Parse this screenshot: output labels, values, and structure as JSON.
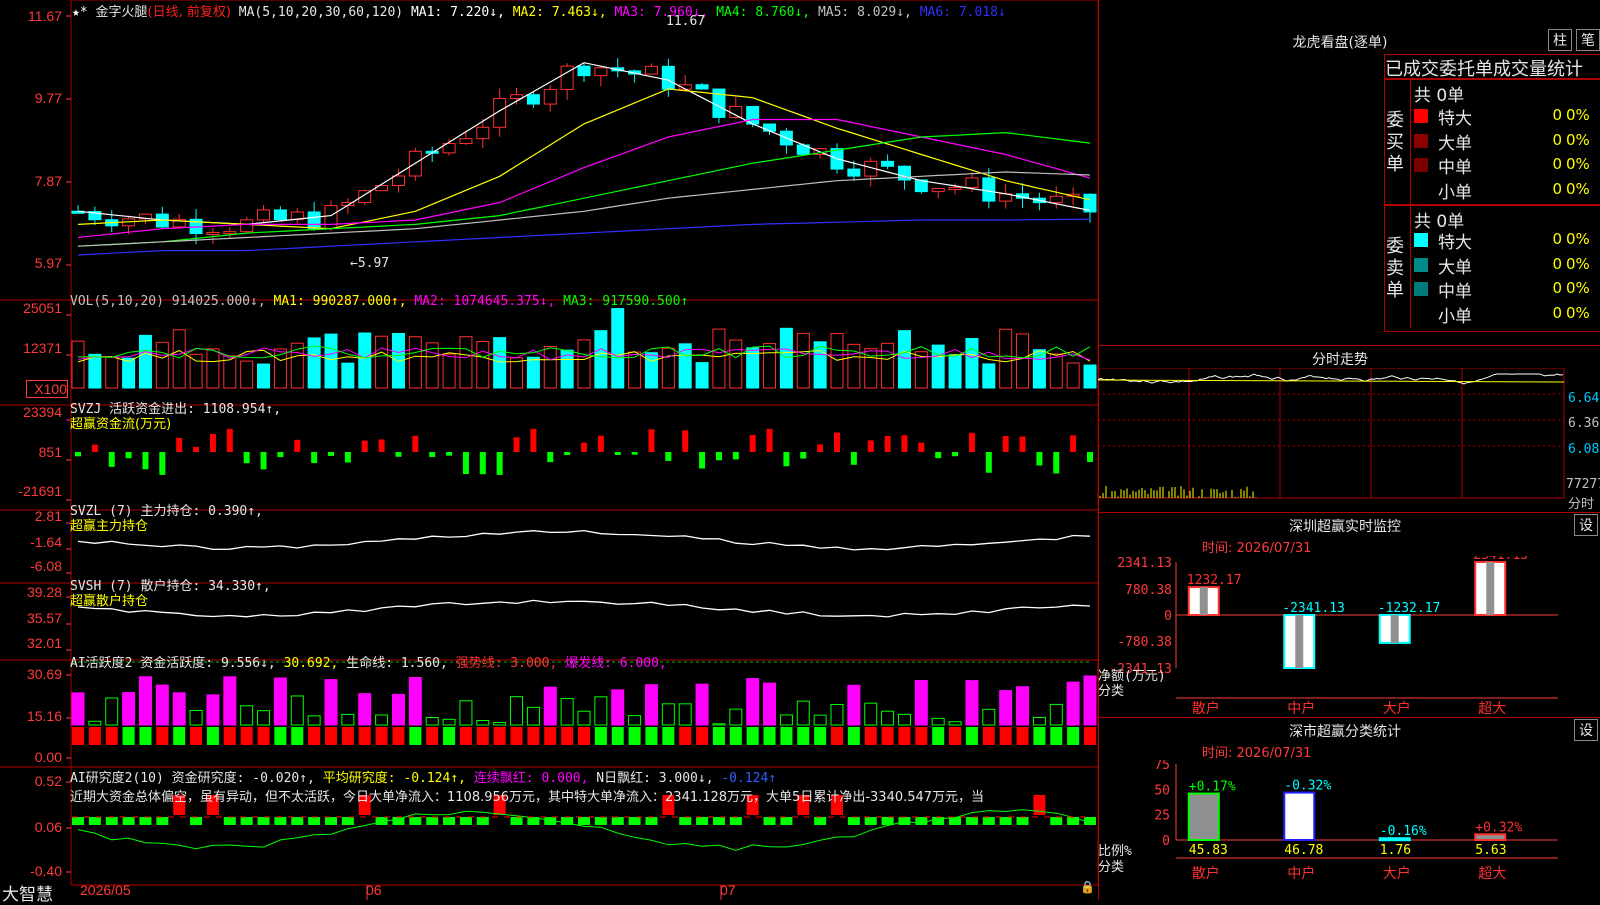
{
  "main_header": {
    "stock_name": "金字火腿",
    "period_label": "(日线, 前复权)",
    "ma_spec": "MA(5,10,20,30,60,120)",
    "ma_items": [
      {
        "label": "MA1: 7.220↓,",
        "color": "#ffffff"
      },
      {
        "label": "MA2: 7.463↓,",
        "color": "#ffff00"
      },
      {
        "label": "MA3: 7.960↓,",
        "color": "#ff00ff"
      },
      {
        "label": "MA4: 8.760↓,",
        "color": "#00ff00"
      },
      {
        "label": "MA5: 8.029↓,",
        "color": "#c0c0c0"
      },
      {
        "label": "MA6: 7.018↓",
        "color": "#3030ff"
      }
    ],
    "y_ticks": [
      "11.67",
      "9.77",
      "7.87",
      "5.97"
    ],
    "high_marker": "11.67",
    "low_marker": "←5.97"
  },
  "vol_panel": {
    "header": "VOL(5,10,20) 914025.000↓, MA1: 990287.000↑, MA2: 1074645.375↓, MA3: 917590.500↑",
    "header_parts": [
      {
        "t": "VOL(5,10,20) 914025.000↓,",
        "c": "#c0c0c0"
      },
      {
        "t": " MA1: 990287.000↑,",
        "c": "#ffff00"
      },
      {
        "t": " MA2: 1074645.375↓,",
        "c": "#ff00ff"
      },
      {
        "t": " MA3: 917590.500↑",
        "c": "#00ff00"
      }
    ],
    "y_ticks": [
      "25051",
      "12371",
      "X100"
    ]
  },
  "svzj_panel": {
    "header": "SVZJ  活跃资金进出: 1108.954↑,",
    "sub": "超赢资金流(万元)",
    "y_ticks": [
      "23394",
      "851",
      "-21691"
    ]
  },
  "svzl_panel": {
    "header": "SVZL (7) 主力持仓: 0.390↑,",
    "sub": "超赢主力持仓",
    "y_ticks": [
      "2.81",
      "-1.64",
      "-6.08"
    ]
  },
  "svsh_panel": {
    "header": "SVSH (7) 散户持仓: 34.330↑,",
    "sub": "超赢散户持仓",
    "y_ticks": [
      "39.28",
      "35.57",
      "32.01"
    ]
  },
  "ai_active_panel": {
    "header_parts": [
      {
        "t": "AI活跃度2 资金活跃度: 9.556↓,",
        "c": "#e6e6e6"
      },
      {
        "t": " 30.692,",
        "c": "#ffff00"
      },
      {
        "t": " 生命线: 1.560,",
        "c": "#e6e6e6"
      },
      {
        "t": " 强势线: 3.000,",
        "c": "#ff3333"
      },
      {
        "t": " 爆发线: 6.000,",
        "c": "#ff00ff"
      }
    ],
    "y_ticks": [
      "30.69",
      "15.16",
      "0.00"
    ]
  },
  "ai_research_panel": {
    "header_parts": [
      {
        "t": "AI研究度2(10) 资金研究度: -0.020↑,",
        "c": "#e6e6e6"
      },
      {
        "t": " 平均研究度: -0.124↑,",
        "c": "#ffff00"
      },
      {
        "t": " 连续飘红: 0.000,",
        "c": "#ff00ff"
      },
      {
        "t": " N日飘红: 3.000↓,",
        "c": "#e6e6e6"
      },
      {
        "t": " -0.124↑",
        "c": "#3060ff"
      }
    ],
    "summary": "近期大资金总体偏空，虽有异动，但不太活跃，今日大单净流入：1108.956万元，其中特大单净流入：2341.128万元，大单5日累计净出-3340.547万元，当",
    "y_ticks": [
      "0.52",
      "0.06",
      "-0.40"
    ]
  },
  "bottom_axis": {
    "brand": "大智慧",
    "dates": [
      "2026/05",
      "06",
      "07"
    ]
  },
  "lhb": {
    "title": "龙虎看盘(逐单)",
    "btn_zhu": "柱",
    "btn_bi": "笔",
    "tabs_header": "已成交委托单成交量统计",
    "buy_label": "委买单",
    "sell_label": "委卖单",
    "buy_total": "共 0单",
    "sell_total": "共 0单",
    "buy_rows": [
      {
        "name": "特大",
        "count": "0",
        "pct": "0%",
        "color": "#ff0000"
      },
      {
        "name": "大单",
        "count": "0",
        "pct": "0%",
        "color": "#8b0000"
      },
      {
        "name": "中单",
        "count": "0",
        "pct": "0%",
        "color": "#7a0000"
      },
      {
        "name": "小单",
        "count": "0",
        "pct": "0%",
        "color": "#000000"
      }
    ],
    "sell_rows": [
      {
        "name": "特大",
        "count": "0",
        "pct": "0%",
        "color": "#00ffff"
      },
      {
        "name": "大单",
        "count": "0",
        "pct": "0%",
        "color": "#008b8b"
      },
      {
        "name": "中单",
        "count": "0",
        "pct": "0%",
        "color": "#007a7a"
      },
      {
        "name": "小单",
        "count": "0",
        "pct": "0%",
        "color": "#000000"
      }
    ]
  },
  "intraday": {
    "title": "分时走势",
    "y_ticks": [
      "6.64",
      "6.36",
      "6.08"
    ],
    "vol_tick": "77277",
    "foot": "分时"
  },
  "sz_monitor": {
    "title": "深圳超赢实时监控",
    "btn": "设",
    "time": "时间: 2026/07/31",
    "y_ticks": [
      "2341.13",
      "780.38",
      "0",
      "-780.38",
      "-2341.13"
    ],
    "ylabel": "净额(万元)",
    "xlabel": "分类",
    "categories": [
      "散户",
      "中户",
      "大户",
      "超大"
    ],
    "values": [
      1232.17,
      -2341.13,
      -1232.17,
      2341.13
    ],
    "value_labels": [
      "1232.17",
      "-2341.13",
      "-1232.17",
      "2341.13"
    ]
  },
  "sz_classify": {
    "title": "深市超赢分类统计",
    "btn": "设",
    "time": "时间: 2026/07/31",
    "y_ticks": [
      "75",
      "50",
      "25",
      "0"
    ],
    "ylabel": "比例%",
    "xlabel": "分类",
    "categories": [
      "散户",
      "中户",
      "大户",
      "超大"
    ],
    "values": [
      45.83,
      46.78,
      1.76,
      5.63
    ],
    "value_labels": [
      "45.83",
      "46.78",
      "1.76",
      "5.63"
    ],
    "change_labels": [
      "+0.17%",
      "-0.32%",
      "-0.16%",
      "+0.32%"
    ]
  },
  "chart_data": [
    {
      "type": "line",
      "title": "金字火腿 (日线, 前复权)",
      "x": [
        "2026/05",
        "06",
        "07"
      ],
      "ylim": [
        5.97,
        11.67
      ],
      "series": [
        {
          "name": "MA1",
          "values": [
            7.2,
            7.0,
            6.9,
            7.1,
            8.3,
            9.5,
            10.6,
            10.2,
            9.2,
            8.4,
            7.9,
            7.6,
            7.22
          ]
        },
        {
          "name": "MA2",
          "values": [
            6.9,
            7.0,
            6.9,
            6.8,
            7.2,
            8.0,
            9.2,
            10.0,
            9.8,
            9.1,
            8.5,
            7.9,
            7.46
          ]
        },
        {
          "name": "MA3",
          "values": [
            6.6,
            6.8,
            6.9,
            6.9,
            7.0,
            7.4,
            8.2,
            8.9,
            9.3,
            9.3,
            8.9,
            8.5,
            7.96
          ]
        },
        {
          "name": "MA4",
          "values": [
            6.4,
            6.5,
            6.7,
            6.8,
            6.9,
            7.1,
            7.5,
            7.9,
            8.3,
            8.6,
            8.9,
            9.0,
            8.76
          ]
        },
        {
          "name": "MA5",
          "values": [
            6.4,
            6.5,
            6.6,
            6.7,
            6.8,
            7.0,
            7.2,
            7.5,
            7.7,
            7.9,
            8.0,
            8.1,
            8.03
          ]
        },
        {
          "name": "MA6",
          "values": [
            6.2,
            6.3,
            6.3,
            6.4,
            6.5,
            6.6,
            6.7,
            6.8,
            6.9,
            6.95,
            7.0,
            7.0,
            7.02
          ]
        }
      ]
    },
    {
      "type": "bar",
      "title": "深圳超赢实时监控",
      "categories": [
        "散户",
        "中户",
        "大户",
        "超大"
      ],
      "values": [
        1232.17,
        -2341.13,
        -1232.17,
        2341.13
      ],
      "ylabel": "净额(万元)",
      "xlabel": "分类",
      "ylim": [
        -2341.13,
        2341.13
      ]
    },
    {
      "type": "bar",
      "title": "深市超赢分类统计",
      "categories": [
        "散户",
        "中户",
        "大户",
        "超大"
      ],
      "values": [
        45.83,
        46.78,
        1.76,
        5.63
      ],
      "ylabel": "比例%",
      "xlabel": "分类",
      "ylim": [
        0,
        75
      ]
    }
  ]
}
